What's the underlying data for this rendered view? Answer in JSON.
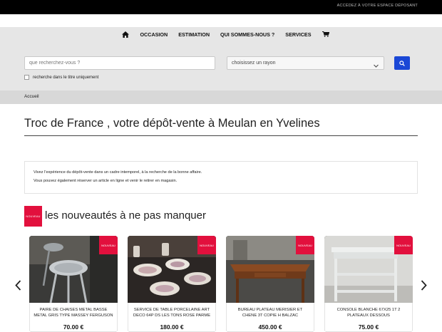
{
  "topbar": {
    "depositor_link": "ACCÉDEZ À VOTRE ESPACE DÉPOSANT"
  },
  "nav": {
    "home_icon": "home-icon",
    "items": [
      "OCCASION",
      "ESTIMATION",
      "QUI SOMMES-NOUS ?",
      "SERVICES"
    ],
    "cart_icon": "cart-icon"
  },
  "search": {
    "placeholder": "que recherchez-vous ?",
    "rayon_selected": "choisissez un rayon",
    "button_icon": "search-icon",
    "title_only_label": "recherche dans le titre uniquement"
  },
  "breadcrumb": {
    "home": "Accueil"
  },
  "page": {
    "title": "Troc de France , votre dépôt-vente à Meulan en Yvelines",
    "intro": [
      "Vivez l'expérience du dépôt-vente dans un cadre intemporel, à la recherche de la bonne affaire.",
      "Vous pouvez également réserver un article en ligne et venir le retirer en magasin."
    ]
  },
  "new_section": {
    "badge": "NOUVEAU",
    "heading": "les nouveautés à ne pas manquer",
    "products": [
      {
        "name": "PAIRE DE CHAISES METAL BASSE METAL GRIS TYPE MASSEY FERGUSON",
        "price": "70.00 €",
        "badge": "NOUVEAU"
      },
      {
        "name": "SERVICE DE TABLE PORCELAINE ART DECO 64P DS LES TONS ROSE PARME",
        "price": "180.00 €",
        "badge": "NOUVEAU"
      },
      {
        "name": "BUREAU PLATEAU MERISIER ET CHENE 3T COPIE H BALZAC",
        "price": "450.00 €",
        "badge": "NOUVEAU"
      },
      {
        "name": "CONSOLE BLANCHE 67X25 1T 2 PLATEAUX DESSOUS",
        "price": "75.00 €",
        "badge": "NOUVEAU"
      }
    ]
  },
  "colors": {
    "accent_red": "#e2103d",
    "search_blue": "#1a47d6",
    "topbar": "#000000"
  }
}
